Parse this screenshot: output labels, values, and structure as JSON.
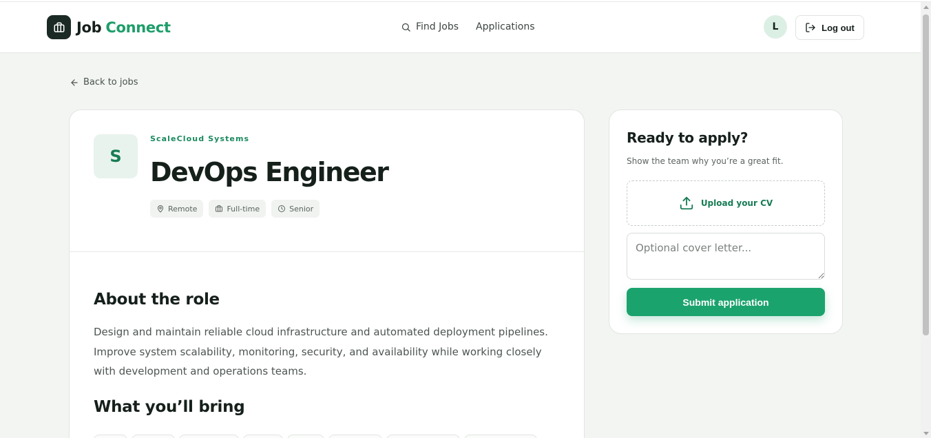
{
  "header": {
    "logo_word_1": "Job",
    "logo_word_2": "Connect",
    "nav": [
      {
        "label": "Find Jobs",
        "icon": "search-icon"
      },
      {
        "label": "Applications"
      }
    ],
    "avatar_initial": "L",
    "logout_label": "Log out"
  },
  "back_label": "Back to jobs",
  "job": {
    "company_initial": "S",
    "company": "ScaleCloud Systems",
    "title": "DevOps Engineer",
    "tags": [
      {
        "label": "Remote",
        "icon": "map-pin-icon"
      },
      {
        "label": "Full-time",
        "icon": "briefcase-icon"
      },
      {
        "label": "Senior",
        "icon": "clock-icon"
      }
    ],
    "about_heading": "About the role",
    "about_text": "Design and maintain reliable cloud infrastructure and automated deployment pipelines. Improve system scalability, monitoring, security, and availability while working closely with development and operations teams.",
    "bring_heading": "What you’ll bring"
  },
  "apply": {
    "title": "Ready to apply?",
    "subtitle": "Show the team why you’re a great fit.",
    "upload_label": "Upload your CV",
    "cover_placeholder": "Optional cover letter...",
    "submit_label": "Submit application"
  },
  "colors": {
    "brand": "#1e9e6a",
    "submit": "#1ba36d",
    "logo_bg": "#1b2a24",
    "page_bg": "#f2f5f2"
  }
}
